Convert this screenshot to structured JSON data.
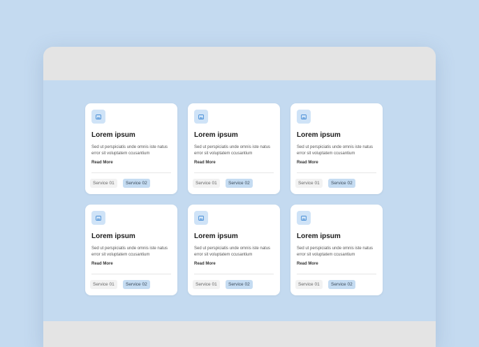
{
  "cards": [
    {
      "icon": "image-icon",
      "title": "Lorem ipsum",
      "description": "Sed ut perspiciatis unde omnis iste natus error sit voluptatem ccusantium",
      "link": "Read More",
      "tags": [
        "Service 01",
        "Service 02"
      ]
    },
    {
      "icon": "image-icon",
      "title": "Lorem ipsum",
      "description": "Sed ut perspiciatis unde omnis iste natus error sit voluptatem ccusantium",
      "link": "Read More",
      "tags": [
        "Service 01",
        "Service 02"
      ]
    },
    {
      "icon": "image-icon",
      "title": "Lorem ipsum",
      "description": "Sed ut perspiciatis unde omnis iste natus error sit voluptatem ccusantium",
      "link": "Read More",
      "tags": [
        "Service 01",
        "Service 02"
      ]
    },
    {
      "icon": "image-icon",
      "title": "Lorem ipsum",
      "description": "Sed ut perspiciatis unde omnis iste natus error sit voluptatem ccusantium",
      "link": "Read More",
      "tags": [
        "Service 01",
        "Service 02"
      ]
    },
    {
      "icon": "image-icon",
      "title": "Lorem ipsum",
      "description": "Sed ut perspiciatis unde omnis iste natus error sit voluptatem ccusantium",
      "link": "Read More",
      "tags": [
        "Service 01",
        "Service 02"
      ]
    },
    {
      "icon": "image-icon",
      "title": "Lorem ipsum",
      "description": "Sed ut perspiciatis unde omnis iste natus error sit voluptatem ccusantium",
      "link": "Read More",
      "tags": [
        "Service 01",
        "Service 02"
      ]
    }
  ],
  "colors": {
    "page_background": "#c4daf0",
    "card_background": "#ffffff",
    "chrome": "#e4e4e4",
    "accent_light": "#cfe3f7",
    "tag_highlight": "#c5dcf2"
  }
}
